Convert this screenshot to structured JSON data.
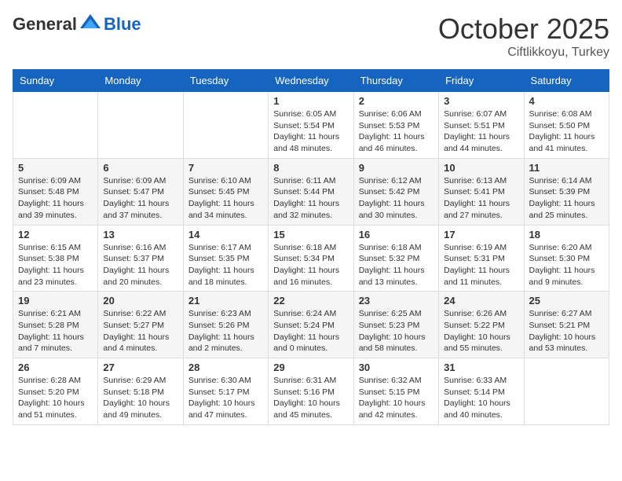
{
  "logo": {
    "general": "General",
    "blue": "Blue"
  },
  "header": {
    "month": "October 2025",
    "location": "Ciftlikkoyu, Turkey"
  },
  "weekdays": [
    "Sunday",
    "Monday",
    "Tuesday",
    "Wednesday",
    "Thursday",
    "Friday",
    "Saturday"
  ],
  "weeks": [
    [
      {
        "day": "",
        "info": ""
      },
      {
        "day": "",
        "info": ""
      },
      {
        "day": "",
        "info": ""
      },
      {
        "day": "1",
        "info": "Sunrise: 6:05 AM\nSunset: 5:54 PM\nDaylight: 11 hours\nand 48 minutes."
      },
      {
        "day": "2",
        "info": "Sunrise: 6:06 AM\nSunset: 5:53 PM\nDaylight: 11 hours\nand 46 minutes."
      },
      {
        "day": "3",
        "info": "Sunrise: 6:07 AM\nSunset: 5:51 PM\nDaylight: 11 hours\nand 44 minutes."
      },
      {
        "day": "4",
        "info": "Sunrise: 6:08 AM\nSunset: 5:50 PM\nDaylight: 11 hours\nand 41 minutes."
      }
    ],
    [
      {
        "day": "5",
        "info": "Sunrise: 6:09 AM\nSunset: 5:48 PM\nDaylight: 11 hours\nand 39 minutes."
      },
      {
        "day": "6",
        "info": "Sunrise: 6:09 AM\nSunset: 5:47 PM\nDaylight: 11 hours\nand 37 minutes."
      },
      {
        "day": "7",
        "info": "Sunrise: 6:10 AM\nSunset: 5:45 PM\nDaylight: 11 hours\nand 34 minutes."
      },
      {
        "day": "8",
        "info": "Sunrise: 6:11 AM\nSunset: 5:44 PM\nDaylight: 11 hours\nand 32 minutes."
      },
      {
        "day": "9",
        "info": "Sunrise: 6:12 AM\nSunset: 5:42 PM\nDaylight: 11 hours\nand 30 minutes."
      },
      {
        "day": "10",
        "info": "Sunrise: 6:13 AM\nSunset: 5:41 PM\nDaylight: 11 hours\nand 27 minutes."
      },
      {
        "day": "11",
        "info": "Sunrise: 6:14 AM\nSunset: 5:39 PM\nDaylight: 11 hours\nand 25 minutes."
      }
    ],
    [
      {
        "day": "12",
        "info": "Sunrise: 6:15 AM\nSunset: 5:38 PM\nDaylight: 11 hours\nand 23 minutes."
      },
      {
        "day": "13",
        "info": "Sunrise: 6:16 AM\nSunset: 5:37 PM\nDaylight: 11 hours\nand 20 minutes."
      },
      {
        "day": "14",
        "info": "Sunrise: 6:17 AM\nSunset: 5:35 PM\nDaylight: 11 hours\nand 18 minutes."
      },
      {
        "day": "15",
        "info": "Sunrise: 6:18 AM\nSunset: 5:34 PM\nDaylight: 11 hours\nand 16 minutes."
      },
      {
        "day": "16",
        "info": "Sunrise: 6:18 AM\nSunset: 5:32 PM\nDaylight: 11 hours\nand 13 minutes."
      },
      {
        "day": "17",
        "info": "Sunrise: 6:19 AM\nSunset: 5:31 PM\nDaylight: 11 hours\nand 11 minutes."
      },
      {
        "day": "18",
        "info": "Sunrise: 6:20 AM\nSunset: 5:30 PM\nDaylight: 11 hours\nand 9 minutes."
      }
    ],
    [
      {
        "day": "19",
        "info": "Sunrise: 6:21 AM\nSunset: 5:28 PM\nDaylight: 11 hours\nand 7 minutes."
      },
      {
        "day": "20",
        "info": "Sunrise: 6:22 AM\nSunset: 5:27 PM\nDaylight: 11 hours\nand 4 minutes."
      },
      {
        "day": "21",
        "info": "Sunrise: 6:23 AM\nSunset: 5:26 PM\nDaylight: 11 hours\nand 2 minutes."
      },
      {
        "day": "22",
        "info": "Sunrise: 6:24 AM\nSunset: 5:24 PM\nDaylight: 11 hours\nand 0 minutes."
      },
      {
        "day": "23",
        "info": "Sunrise: 6:25 AM\nSunset: 5:23 PM\nDaylight: 10 hours\nand 58 minutes."
      },
      {
        "day": "24",
        "info": "Sunrise: 6:26 AM\nSunset: 5:22 PM\nDaylight: 10 hours\nand 55 minutes."
      },
      {
        "day": "25",
        "info": "Sunrise: 6:27 AM\nSunset: 5:21 PM\nDaylight: 10 hours\nand 53 minutes."
      }
    ],
    [
      {
        "day": "26",
        "info": "Sunrise: 6:28 AM\nSunset: 5:20 PM\nDaylight: 10 hours\nand 51 minutes."
      },
      {
        "day": "27",
        "info": "Sunrise: 6:29 AM\nSunset: 5:18 PM\nDaylight: 10 hours\nand 49 minutes."
      },
      {
        "day": "28",
        "info": "Sunrise: 6:30 AM\nSunset: 5:17 PM\nDaylight: 10 hours\nand 47 minutes."
      },
      {
        "day": "29",
        "info": "Sunrise: 6:31 AM\nSunset: 5:16 PM\nDaylight: 10 hours\nand 45 minutes."
      },
      {
        "day": "30",
        "info": "Sunrise: 6:32 AM\nSunset: 5:15 PM\nDaylight: 10 hours\nand 42 minutes."
      },
      {
        "day": "31",
        "info": "Sunrise: 6:33 AM\nSunset: 5:14 PM\nDaylight: 10 hours\nand 40 minutes."
      },
      {
        "day": "",
        "info": ""
      }
    ]
  ]
}
